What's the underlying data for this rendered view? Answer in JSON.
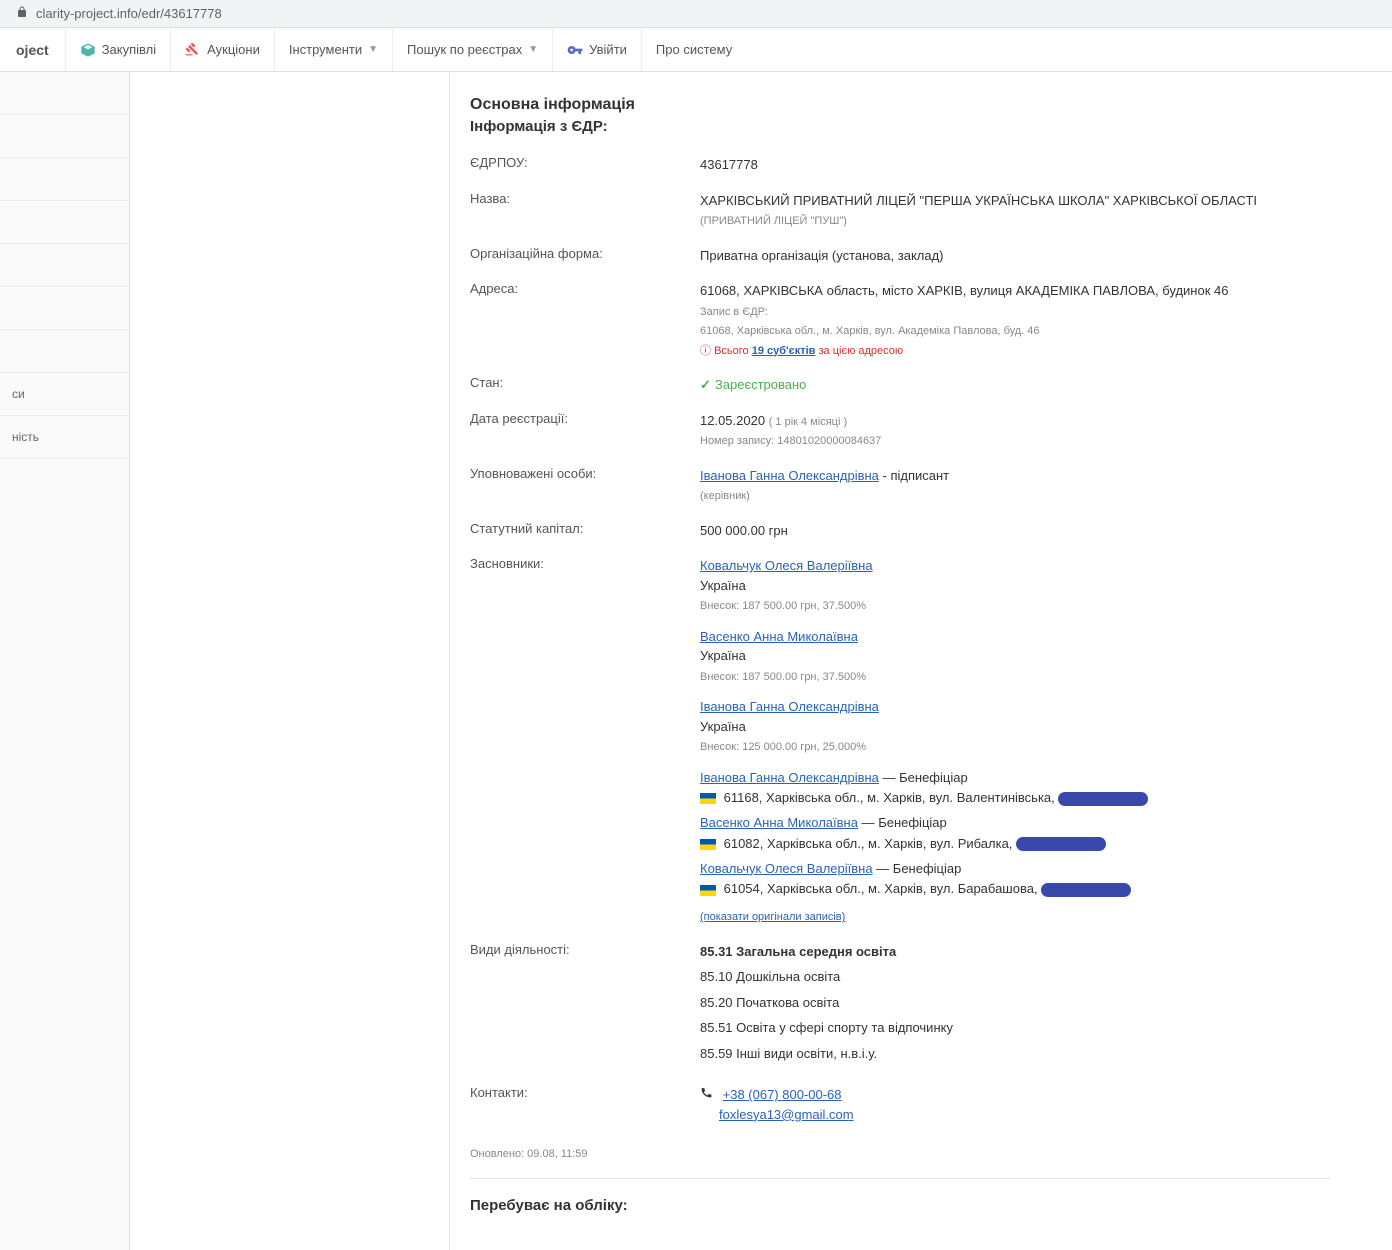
{
  "url": "clarity-project.info/edr/43617778",
  "nav": {
    "brand": "oject",
    "zakupivli": "Закупівлі",
    "auctions": "Аукціони",
    "instruments": "Інструменти",
    "registers": "Пошук по реєстрах",
    "login": "Увійти",
    "about": "Про систему"
  },
  "sidebar": {
    "item1": "си",
    "item2": "ність"
  },
  "section": {
    "main_title": "Основна інформація",
    "edr_title": "Інформація з ЄДР:",
    "onrecord_title": "Перебуває на обліку:"
  },
  "fields": {
    "edrpou_label": "ЄДРПОУ:",
    "edrpou_value": "43617778",
    "name_label": "Назва:",
    "name_value": "ХАРКІВСЬКИЙ ПРИВАТНИЙ ЛІЦЕЙ \"ПЕРША УКРАЇНСЬКА ШКОЛА\" ХАРКІВСЬКОЇ ОБЛАСТІ",
    "name_short": "(ПРИВАТНИЙ ЛІЦЕЙ \"ПУШ\")",
    "orgform_label": "Організаційна форма:",
    "orgform_value": "Приватна організація (установа, заклад)",
    "address_label": "Адреса:",
    "address_value": "61068, ХАРКІВСЬКА область, місто ХАРКІВ, вулиця АКАДЕМІКА ПАВЛОВА, будинок 46",
    "address_edr_label": "Запис в ЄДР:",
    "address_edr_value": "61068, Харківська обл., м. Харків, вул. Академіка Павлова, буд. 46",
    "address_count_prefix": "Всього ",
    "address_count_link": "19 суб'єктів",
    "address_count_suffix": " за цією адресою",
    "status_label": "Стан:",
    "status_value": "Зареєстровано",
    "regdate_label": "Дата реєстрації:",
    "regdate_value": "12.05.2020",
    "regdate_age": "( 1 рік 4 місяці )",
    "regnumber": "Номер запису: 14801020000084637",
    "persons_label": "Уповноважені особи:",
    "person_name": "Іванова Ганна Олександрівна",
    "person_role": " - підписант",
    "person_subrole": "(керівник)",
    "capital_label": "Статутний капітал:",
    "capital_value": "500 000.00 грн",
    "founders_label": "Засновники:",
    "activities_label": "Види діяльності:",
    "contacts_label": "Контакти:",
    "phone": "+38 (067) 800-00-68",
    "email": "foxlesya13@gmail.com",
    "updated": "Оновлено: 09.08, 11:59",
    "show_originals": "(показати оригінали записів)"
  },
  "founders": {
    "f1_name": "Ковальчук Олеся Валеріївна",
    "f1_country": "Україна",
    "f1_share": "Внесок: 187 500.00 грн, 37.500%",
    "f2_name": "Васенко Анна Миколаївна",
    "f2_country": "Україна",
    "f2_share": "Внесок: 187 500.00 грн, 37.500%",
    "f3_name": "Іванова Ганна Олександрівна",
    "f3_country": "Україна",
    "f3_share": "Внесок: 125 000.00 грн, 25.000%"
  },
  "beneficiaries": {
    "b1_name": "Іванова Ганна Олександрівна",
    "b1_role": " — Бенефіціар",
    "b1_addr": " 61168, Харківська обл., м. Харків, вул. Валентинівська, ",
    "b2_name": "Васенко Анна Миколаївна",
    "b2_role": " — Бенефіціар",
    "b2_addr": " 61082, Харківська обл., м. Харків, вул. Рибалка, ",
    "b3_name": "Ковальчук Олеся Валеріївна",
    "b3_role": " — Бенефіціар",
    "b3_addr": " 61054, Харківська обл., м. Харків, вул. Барабашова, "
  },
  "activities": {
    "a1": "85.31 Загальна середня освіта",
    "a2": "85.10 Дошкільна освіта",
    "a3": "85.20 Початкова освіта",
    "a4": "85.51 Освіта у сфері спорту та відпочинку",
    "a5": "85.59 Інші види освіти, н.в.і.у."
  }
}
